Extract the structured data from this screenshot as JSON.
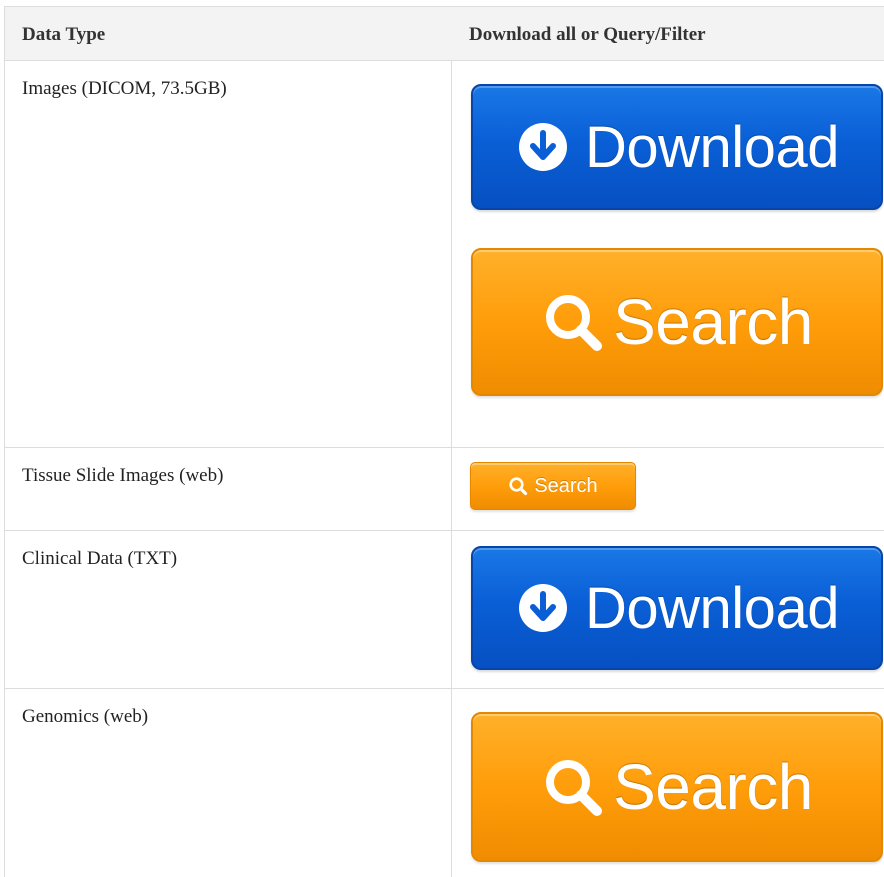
{
  "table": {
    "headers": {
      "data_type": "Data Type",
      "download": "Download all or Query/Filter"
    },
    "rows": [
      {
        "label": "Images (DICOM, 73.5GB)",
        "buttons": [
          {
            "label": "Download",
            "icon": "download-circle-icon",
            "color": "#0a5fd6"
          },
          {
            "label": "Search",
            "icon": "search-icon",
            "color": "#ff9d0a"
          }
        ]
      },
      {
        "label": "Tissue Slide Images (web)",
        "buttons": [
          {
            "label": "Search",
            "icon": "search-icon",
            "color": "#ff9d0a"
          }
        ]
      },
      {
        "label": "Clinical Data (TXT)",
        "buttons": [
          {
            "label": "Download",
            "icon": "download-circle-icon",
            "color": "#0a5fd6"
          }
        ]
      },
      {
        "label": "Genomics (web)",
        "buttons": [
          {
            "label": "Search",
            "icon": "search-icon",
            "color": "#ff9d0a"
          }
        ]
      }
    ]
  },
  "colors": {
    "download_blue": "#0a5fd6",
    "search_orange": "#ff9d0a",
    "header_bg": "#f3f3f3",
    "border": "#dcdcdc"
  }
}
